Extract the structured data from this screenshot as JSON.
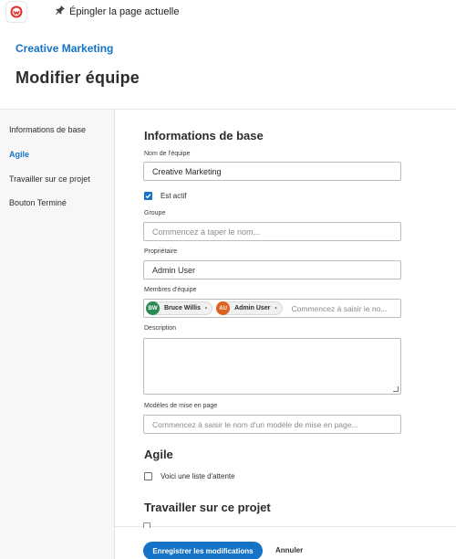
{
  "topbar": {
    "pin_label": "Épingler la page actuelle"
  },
  "header": {
    "breadcrumb": "Creative Marketing",
    "title": "Modifier équipe"
  },
  "sidebar": {
    "items": [
      {
        "label": "Informations de base",
        "active": false
      },
      {
        "label": "Agile",
        "active": true
      },
      {
        "label": "Travailler sur ce projet",
        "active": false
      },
      {
        "label": "Bouton Terminé",
        "active": false
      }
    ]
  },
  "form": {
    "section_basic": "Informations de base",
    "team_name_label": "Nom de l'équipe",
    "team_name_value": "Creative Marketing",
    "is_active_label": "Est actif",
    "is_active_checked": true,
    "group_label": "Groupe",
    "group_placeholder": "Commencez à taper le nom...",
    "owner_label": "Propriétaire",
    "owner_value": "Admin User",
    "members_label": "Membres d'équipe",
    "members": [
      {
        "initials": "BW",
        "name": "Bruce Willis",
        "color": "#2d8a55"
      },
      {
        "initials": "AU",
        "name": "Admin User",
        "color": "#e0611f"
      }
    ],
    "members_placeholder": "Commencez à saisir le no...",
    "description_label": "Description",
    "layout_templates_label": "Modèles de mise en page",
    "layout_templates_placeholder": "Commencez à saisir le nom d'un modèle de mise en page...",
    "section_agile": "Agile",
    "backlog_label": "Voici une liste d'attente",
    "backlog_checked": false,
    "section_work": "Travailler sur ce projet"
  },
  "footer": {
    "save_label": "Enregistrer les modifications",
    "cancel_label": "Annuler"
  },
  "colors": {
    "accent": "#1473c6",
    "brand_logo": "#e22d2d"
  },
  "icons": {
    "logo": "workfront-logo-icon",
    "pin": "pin-icon",
    "check": "check-icon",
    "remove": "close-icon"
  }
}
